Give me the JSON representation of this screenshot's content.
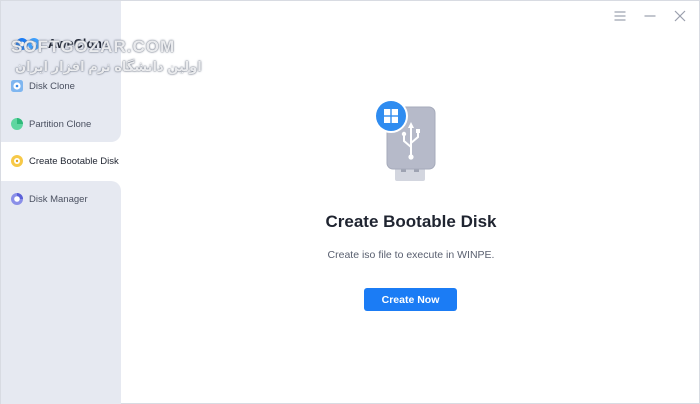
{
  "app": {
    "name": "AweClone"
  },
  "watermark": {
    "line1": "SOFTGOZAR.COM",
    "line2": "اولین دانشگاه نرم افزار ایران"
  },
  "sidebar": {
    "items": [
      {
        "label": "Disk Clone",
        "icon": "disk-clone-icon",
        "active": false
      },
      {
        "label": "Partition Clone",
        "icon": "partition-clone-icon",
        "active": false
      },
      {
        "label": "Create Bootable Disk",
        "icon": "bootable-disk-icon",
        "active": true
      },
      {
        "label": "Disk Manager",
        "icon": "disk-manager-icon",
        "active": false
      }
    ]
  },
  "window_controls": {
    "menu": "menu-icon",
    "minimize": "minimize-icon",
    "close": "close-icon"
  },
  "main": {
    "title": "Create Bootable Disk",
    "subtitle": "Create iso file to execute in WINPE.",
    "button_label": "Create Now"
  },
  "colors": {
    "accent": "#1b7cf5",
    "sidebar_bg": "#e6e9f1",
    "usb_body": "#b6bac9",
    "windows_badge": "#2f8cf0"
  }
}
